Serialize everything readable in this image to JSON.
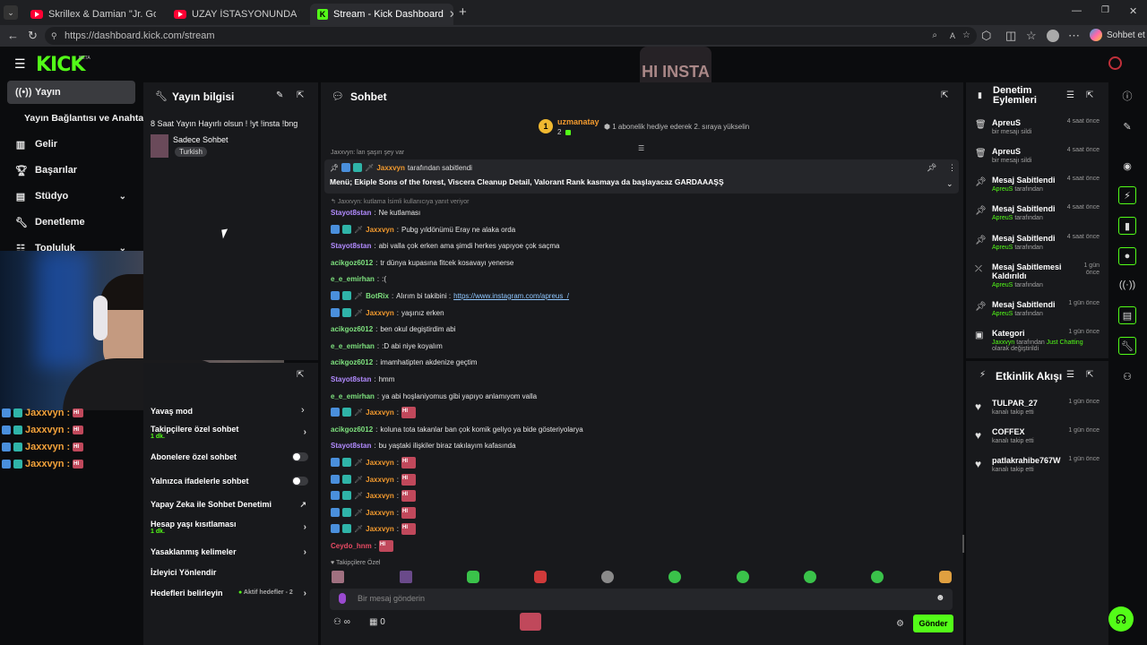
{
  "browser": {
    "tabs": [
      {
        "label": "Skrillex & Damian \"Jr. Gong\" M",
        "type": "youtube"
      },
      {
        "label": "UZAY İSTASYONUNDA TEMİZLİKÇİ",
        "type": "youtube"
      },
      {
        "label": "Stream - Kick Dashboard",
        "type": "kick"
      }
    ],
    "url": "https://dashboard.kick.com/stream",
    "copilot_label": "Sohbet et",
    "new_tab": "+"
  },
  "header": {
    "logo": "KICK",
    "beta": "BETA",
    "watermark": "HI INSTA"
  },
  "sidebar": {
    "items": [
      {
        "label": "Yayın",
        "icon": "broadcast-icon"
      },
      {
        "label": "Yayın Bağlantısı ve Anahtarı",
        "icon": ""
      },
      {
        "label": "Gelir",
        "icon": "chart-icon"
      },
      {
        "label": "Başarılar",
        "icon": "trophy-icon"
      },
      {
        "label": "Stüdyo",
        "icon": "studio-icon"
      },
      {
        "label": "Denetleme",
        "icon": "wrench-icon"
      },
      {
        "label": "Topluluk",
        "icon": "community-icon"
      }
    ],
    "overlay_chat": [
      "Jaxxvyn :",
      "Jaxxvyn :",
      "Jaxxvyn :",
      "Jaxxvyn :"
    ]
  },
  "stream_info": {
    "title": "Yayın bilgisi",
    "stream_title": "8 Saat Yayın Hayırlı olsun ! !yt !insta !bng",
    "category": "Sadece Sohbet",
    "language": "Turkish"
  },
  "chat_settings": {
    "partial_label": "Yavaş mod",
    "rows": [
      {
        "label": "Takipçilere özel sohbet",
        "sub": "1 dk.",
        "control": "arrow"
      },
      {
        "label": "Abonelere özel sohbet",
        "sub": "",
        "control": "toggle"
      },
      {
        "label": "Yalnızca ifadelerle sohbet",
        "sub": "",
        "control": "toggle"
      },
      {
        "label": "Yapay Zeka ile Sohbet Denetimi",
        "sub": "",
        "control": "external"
      },
      {
        "label": "Hesap yaşı kısıtlaması",
        "sub": "1 dk.",
        "control": "arrow"
      },
      {
        "label": "Yasaklanmış kelimeler",
        "sub": "",
        "control": "arrow"
      },
      {
        "label": "İzleyici Yönlendir",
        "sub": "",
        "control": "none"
      },
      {
        "label": "Hedefleri belirleyin",
        "sub": "",
        "control": "arrow",
        "extra": "Aktif hedefler - 2"
      }
    ]
  },
  "chat": {
    "title": "Sohbet",
    "top_gifter": {
      "name": "uzmanatay",
      "count": "2",
      "rank": "1",
      "promo": "1 abonelik hediye ederek 2. sıraya yükselin"
    },
    "pinned": {
      "by": "Jaxxvyn",
      "by_suffix": "tarafından sabitlendi",
      "text": "Menü; Ekiple Sons of the forest, Viscera Cleanup Detail, Valorant Rank kasmaya da başlayacaz GARDAAAŞŞ"
    },
    "partial_top": "Jaxxvyn: lan şaşırı şey var",
    "reply_note": "Jaxxvyn: kutlama İsimli kullanıcıya yanıt veriyor",
    "messages": [
      {
        "user": "Stayot8stan",
        "color": "purple",
        "text": "Ne kutlaması",
        "badges": false
      },
      {
        "user": "Jaxxvyn",
        "color": "orange",
        "text": "Pubg yıldönümü Eray ne alaka orda",
        "badges": true
      },
      {
        "user": "Stayot8stan",
        "color": "purple",
        "text": "abi valla çok erken ama şimdi herkes yapıyoe çok saçma",
        "badges": false
      },
      {
        "user": "acikgoz6012",
        "color": "green",
        "text": "tr dünya kupasına fitcek kosavayı yenerse",
        "badges": false
      },
      {
        "user": "e_e_emirhan",
        "color": "green",
        "text": ":(",
        "badges": false
      },
      {
        "user": "BotRix",
        "color": "green",
        "text": "Alırım bi takibini : ",
        "link": "https://www.instagram.com/apreus_/",
        "badges": true
      },
      {
        "user": "Jaxxvyn",
        "color": "orange",
        "text": "yaşınız erken",
        "badges": true
      },
      {
        "user": "acikgoz6012",
        "color": "green",
        "text": "ben okul degiştirdim abi",
        "badges": false
      },
      {
        "user": "e_e_emirhan",
        "color": "green",
        "text": ":D abi niye koyalım",
        "badges": false
      },
      {
        "user": "acikgoz6012",
        "color": "green",
        "text": "imamhatipten akdenize geçtim",
        "badges": false
      },
      {
        "user": "Stayot8stan",
        "color": "purple",
        "text": "hmm",
        "badges": false
      },
      {
        "user": "e_e_emirhan",
        "color": "green",
        "text": "ya abi hoşlaniyomus gibi yapıyo anlamıyom valla",
        "badges": false
      },
      {
        "user": "Jaxxvyn",
        "color": "orange",
        "text": "",
        "emote": true,
        "badges": true
      },
      {
        "user": "acikgoz6012",
        "color": "green",
        "text": "koluna tota takanlar ban çok komik geliyo ya bide gösteriyolarya",
        "badges": false
      },
      {
        "user": "Stayot8stan",
        "color": "purple",
        "text": "bu yaştaki ilişkiler biraz takılayım kafasında",
        "badges": false
      },
      {
        "user": "Jaxxvyn",
        "color": "orange",
        "text": "",
        "emote": true,
        "badges": true
      },
      {
        "user": "Jaxxvyn",
        "color": "orange",
        "text": "",
        "emote": true,
        "badges": true
      },
      {
        "user": "Jaxxvyn",
        "color": "orange",
        "text": "",
        "emote": true,
        "badges": true
      },
      {
        "user": "Jaxxvyn",
        "color": "orange",
        "text": "",
        "emote": true,
        "badges": true
      },
      {
        "user": "Jaxxvyn",
        "color": "orange",
        "text": "",
        "emote": true,
        "badges": true
      },
      {
        "user": "Ceydo_hnm",
        "color": "red",
        "text": "",
        "emote": true,
        "badges": false
      }
    ],
    "followers_only_label": "Takipçilere Özel",
    "input_placeholder": "Bir mesaj gönderin",
    "send_label": "Gönder",
    "infinite": "∞",
    "count": "0"
  },
  "moderation": {
    "title": "Denetim Eylemleri",
    "items": [
      {
        "title": "ApreuS",
        "sub": "bir mesajı sildi",
        "actor": "",
        "time": "4 saat önce",
        "icon": "trash-icon"
      },
      {
        "title": "ApreuS",
        "sub": "bir mesajı sildi",
        "actor": "",
        "time": "4 saat önce",
        "icon": "trash-icon"
      },
      {
        "title": "Mesaj Sabitlendi",
        "sub": "tarafından",
        "actor": "ApreuS",
        "time": "4 saat önce",
        "icon": "pin-icon"
      },
      {
        "title": "Mesaj Sabitlendi",
        "sub": "tarafından",
        "actor": "ApreuS",
        "time": "4 saat önce",
        "icon": "pin-icon"
      },
      {
        "title": "Mesaj Sabitlendi",
        "sub": "tarafından",
        "actor": "ApreuS",
        "time": "4 saat önce",
        "icon": "pin-icon"
      },
      {
        "title": "Mesaj Sabitlemesi Kaldırıldı",
        "sub": "tarafından",
        "actor": "ApreuS",
        "time": "1 gün önce",
        "icon": "unpin-icon"
      },
      {
        "title": "Mesaj Sabitlendi",
        "sub": "tarafından",
        "actor": "ApreuS",
        "time": "1 gün önce",
        "icon": "pin-icon"
      },
      {
        "title": "Kategori",
        "sub": "tarafından",
        "actor": "Jaxxvyn",
        "category": "Just Chatting",
        "sub2": "olarak değiştirildi",
        "time": "1 gün önce",
        "icon": "category-icon"
      }
    ]
  },
  "activity": {
    "title": "Etkinlik Akışı",
    "items": [
      {
        "name": "TULPAR_27",
        "sub": "kanalı takip etti",
        "time": "1 gün önce"
      },
      {
        "name": "COFFEX",
        "sub": "kanalı takip etti",
        "time": "1 gün önce"
      },
      {
        "name": "patlakrahibe767W",
        "sub": "kanalı takip etti",
        "time": "1 gün önce"
      }
    ]
  }
}
